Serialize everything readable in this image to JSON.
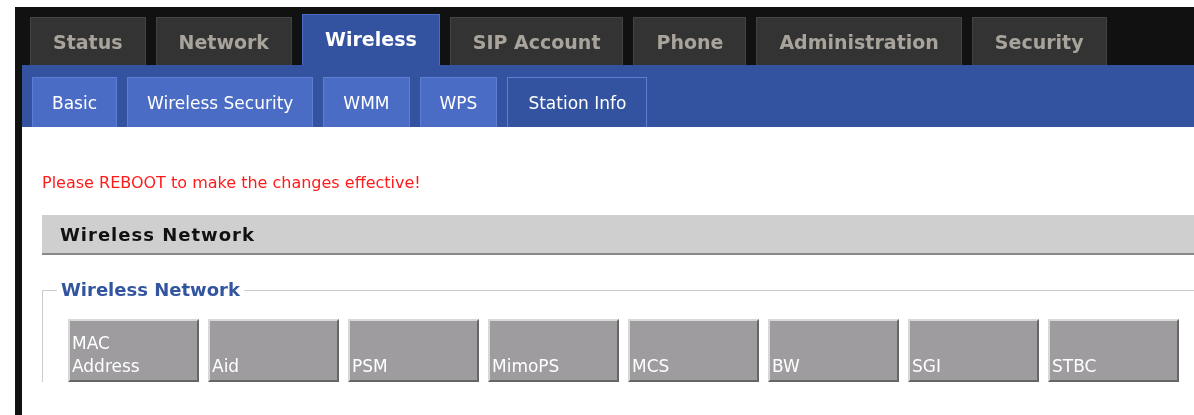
{
  "main_tabs": [
    {
      "label": "Status",
      "selected": false
    },
    {
      "label": "Network",
      "selected": false
    },
    {
      "label": "Wireless",
      "selected": true
    },
    {
      "label": "SIP Account",
      "selected": false
    },
    {
      "label": "Phone",
      "selected": false
    },
    {
      "label": "Administration",
      "selected": false
    },
    {
      "label": "Security",
      "selected": false
    }
  ],
  "sub_tabs": [
    {
      "label": "Basic",
      "selected": false
    },
    {
      "label": "Wireless Security",
      "selected": false
    },
    {
      "label": "WMM",
      "selected": false
    },
    {
      "label": "WPS",
      "selected": false
    },
    {
      "label": "Station Info",
      "selected": true
    }
  ],
  "notice": "Please REBOOT to make the changes effective!",
  "section_title": "Wireless Network",
  "fieldset": {
    "legend": "Wireless Network",
    "table": {
      "columns": [
        "MAC Address",
        "Aid",
        "PSM",
        "MimoPS",
        "MCS",
        "BW",
        "SGI",
        "STBC"
      ]
    }
  }
}
